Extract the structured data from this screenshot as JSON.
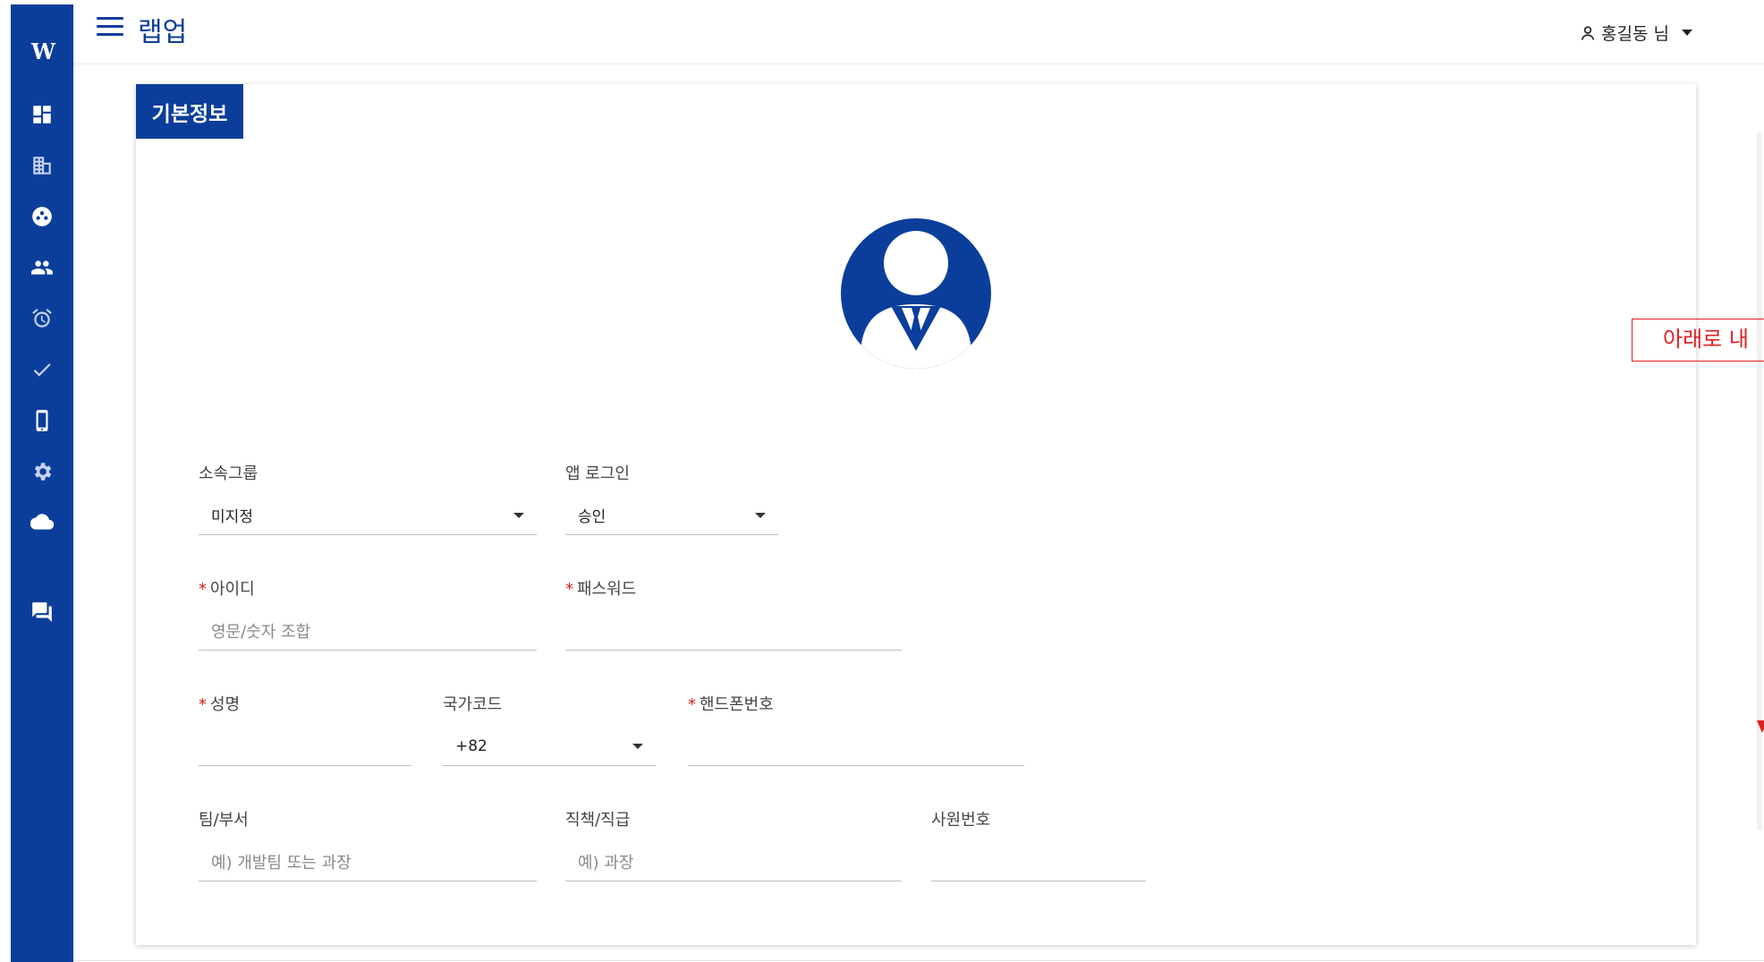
{
  "app": {
    "logo": "W",
    "title": "랩업"
  },
  "user": {
    "name": "홍길동 님"
  },
  "sidebar": {
    "icons": [
      "dashboard-icon",
      "building-icon",
      "group-circle-icon",
      "people-icon",
      "alarm-icon",
      "check-icon",
      "phone-icon",
      "gear-icon",
      "cloud-icon",
      "chat-icon"
    ]
  },
  "card": {
    "tab_label": "기본정보"
  },
  "form": {
    "group": {
      "label": "소속그룹",
      "value": "미지정"
    },
    "app_login": {
      "label": "앱 로그인",
      "value": "승인"
    },
    "user_id": {
      "required_mark": "*",
      "label": "아이디",
      "placeholder": "영문/숫자 조합"
    },
    "password": {
      "required_mark": "*",
      "label": "패스워드",
      "value": ""
    },
    "name": {
      "required_mark": "*",
      "label": "성명",
      "value": ""
    },
    "country_code": {
      "label": "국가코드",
      "value": "+82"
    },
    "phone": {
      "required_mark": "*",
      "label": "핸드폰번호",
      "value": ""
    },
    "team": {
      "label": "팀/부서",
      "placeholder": "예) 개발팀 또는 과장"
    },
    "position": {
      "label": "직책/직급",
      "placeholder": "예) 과장"
    },
    "employee_no": {
      "label": "사원번호",
      "value": ""
    }
  },
  "annotation": {
    "text": "아래로 내",
    "color": "#e02020"
  },
  "colors": {
    "brand": "#0b3e9b",
    "required": "#e02020"
  }
}
